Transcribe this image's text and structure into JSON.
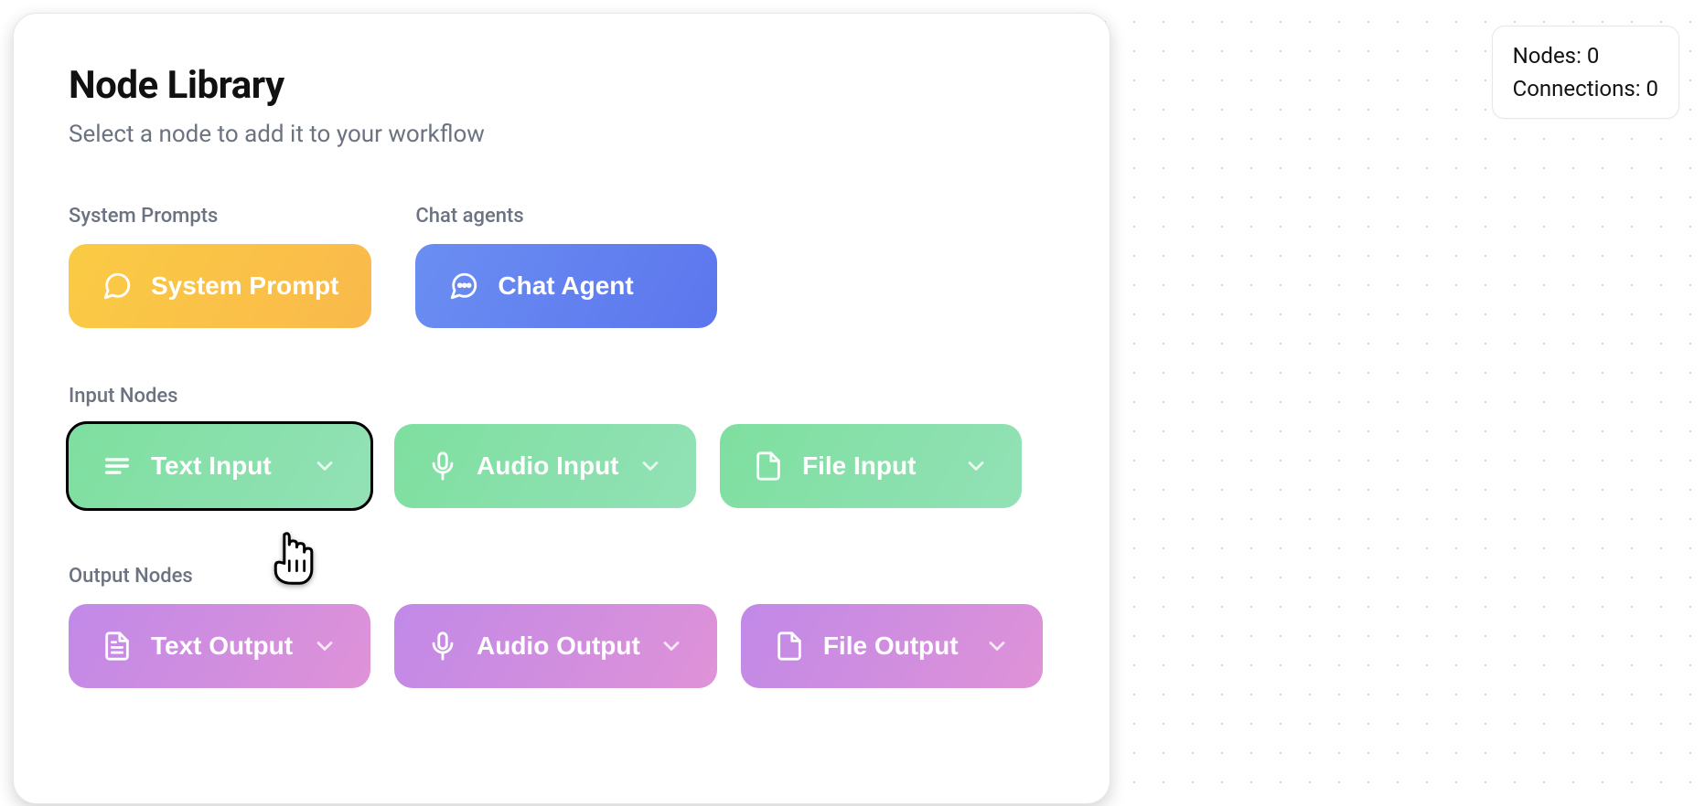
{
  "panel": {
    "title": "Node Library",
    "subtitle": "Select a node to add it to your workflow"
  },
  "sections": {
    "system_prompts": {
      "label": "System Prompts",
      "button": "System Prompt"
    },
    "chat_agents": {
      "label": "Chat agents",
      "button": "Chat Agent"
    },
    "input_nodes": {
      "label": "Input Nodes",
      "text": "Text Input",
      "audio": "Audio Input",
      "file": "File Input"
    },
    "output_nodes": {
      "label": "Output Nodes",
      "text": "Text Output",
      "audio": "Audio Output",
      "file": "File Output"
    }
  },
  "status": {
    "nodes_label": "Nodes:",
    "nodes_count": "0",
    "connections_label": "Connections:",
    "connections_count": "0"
  }
}
